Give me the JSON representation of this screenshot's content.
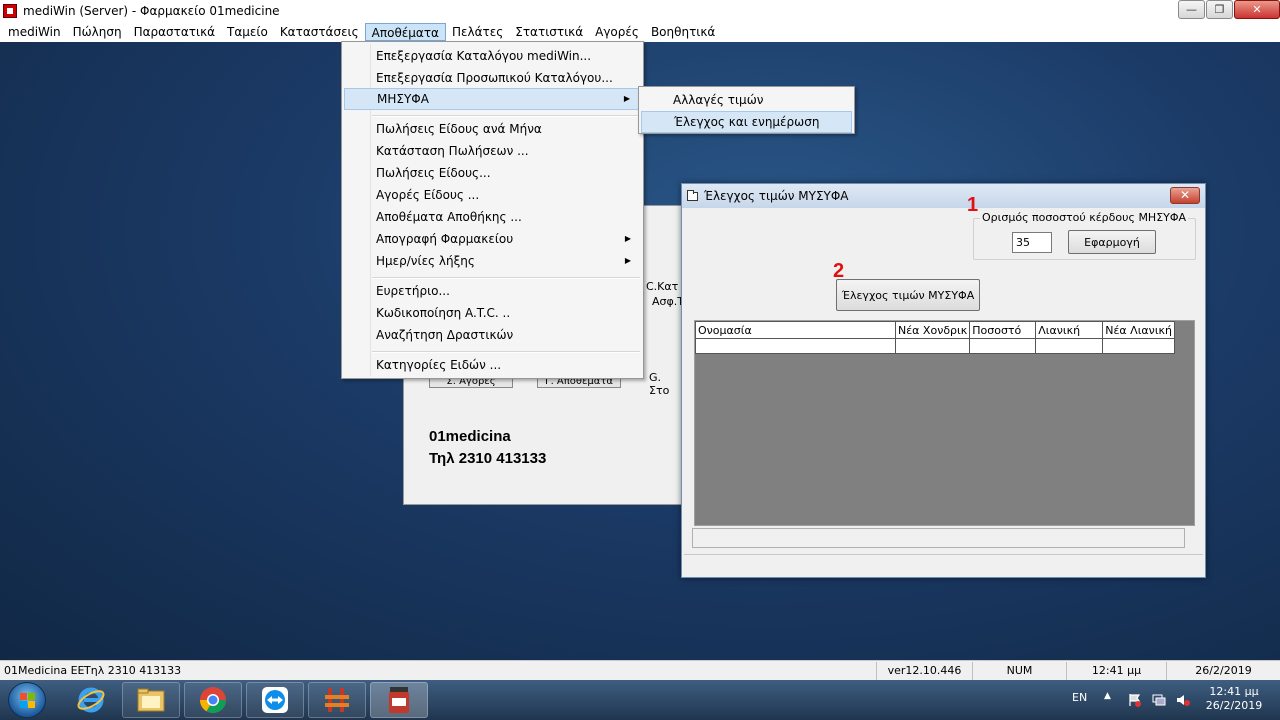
{
  "window": {
    "title": "mediWin (Server) - Φαρμακείο 01medicine",
    "minimize_glyph": "—",
    "restore_glyph": "❐",
    "close_glyph": "✕"
  },
  "menubar": [
    "mediWin",
    "Πώληση",
    "Παραστατικά",
    "Ταμείο",
    "Καταστάσεις",
    "Αποθέματα",
    "Πελάτες",
    "Στατιστικά",
    "Αγορές",
    "Βοηθητικά"
  ],
  "dropdown": {
    "items": [
      {
        "label": "Επεξεργασία Καταλόγου mediWin..."
      },
      {
        "label": "Επεξεργασία Προσωπικού Καταλόγου..."
      },
      {
        "label": "ΜΗΣΥΦΑ",
        "submenu": true
      },
      {
        "label": "Πωλήσεις Είδους ανά Μήνα"
      },
      {
        "label": "Κατάσταση Πωλήσεων ..."
      },
      {
        "label": "Πωλήσεις Είδους..."
      },
      {
        "label": "Αγορές Είδους ..."
      },
      {
        "label": "Αποθέματα Αποθήκης ..."
      },
      {
        "label": "Απογραφή Φαρμακείου",
        "submenu": true
      },
      {
        "label": "Ημερ/νίες λήξης",
        "submenu": true
      },
      {
        "label": "Ευρετήριο..."
      },
      {
        "label": "Κωδικοποίηση A.T.C. .."
      },
      {
        "label": "Αναζήτηση Δραστικών"
      },
      {
        "label": "Κατηγορίες Ειδών ..."
      }
    ],
    "arrow": "▶"
  },
  "submenu": {
    "items": [
      "Αλλαγές τιμών",
      "Έλεγχος και ενημέρωση"
    ]
  },
  "background_window": {
    "company": "01medicina",
    "phone": "Τηλ 2310 413133",
    "frag1a": "C.Κατ",
    "frag1b": "Ασφ.Τ",
    "frag2": "G. Στο",
    "frag_btn1": "Σ. Αγορές",
    "frag_btn2": "Γ. Αποθέματα"
  },
  "dialog": {
    "title": "Έλεγχος τιμών ΜΥΣΥΦΑ",
    "close_glyph": "✕",
    "group_label": "Ορισμός ποσοστού κέρδους  ΜΗΣΥΦΑ",
    "percent_value": "35",
    "apply_button": "Εφαρμογή",
    "check_button": "Έλεγχος τιμών ΜΥΣΥΦΑ",
    "marker1": "1",
    "marker2": "2",
    "columns": [
      "Ονομασία",
      "Νέα Χονδρικ",
      "Ποσοστό",
      "Λιανική",
      "Νέα Λιανική"
    ]
  },
  "statusbar": {
    "company": "01Medicina EE",
    "phone": "Τηλ 2310 413133",
    "version": "ver12.10.446",
    "numlock": "NUM",
    "time": "12:41 μμ",
    "date": "26/2/2019"
  },
  "taskbar": {
    "lang": "EN",
    "tray_arrow": "▲",
    "clock_time": "12:41 μμ",
    "clock_date": "26/2/2019"
  },
  "colors": {
    "desktop": "#1b3a66",
    "highlight": "#d5e6f6",
    "marker": "#e01010"
  }
}
